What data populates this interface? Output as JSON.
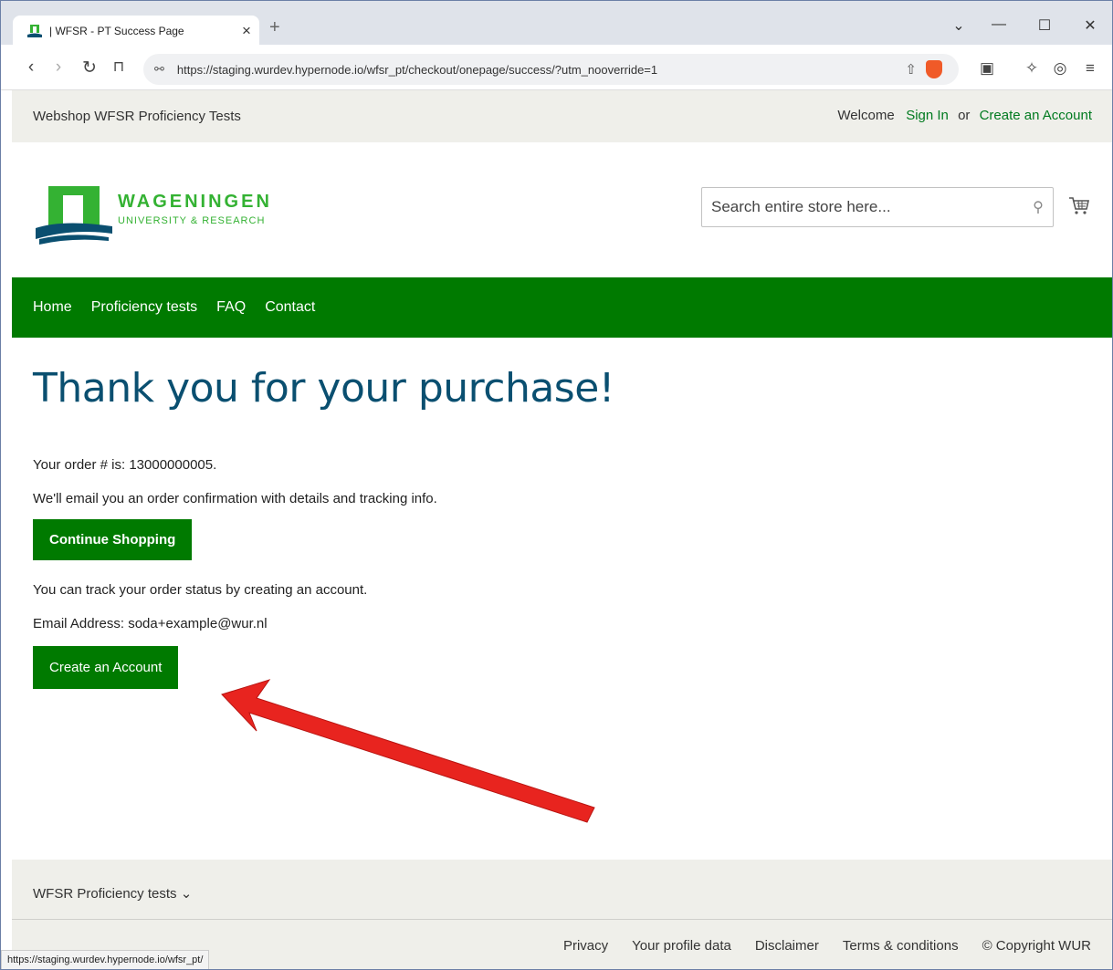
{
  "browser": {
    "tab_title": "| WFSR - PT Success Page",
    "url": "https://staging.wurdev.hypernode.io/wfsr_pt/checkout/onepage/success/?utm_nooverride=1",
    "status_url": "https://staging.wurdev.hypernode.io/wfsr_pt/"
  },
  "topbar": {
    "store_name": "Webshop WFSR Proficiency Tests",
    "welcome": "Welcome",
    "sign_in": "Sign In",
    "or": "or",
    "create_account": "Create an Account"
  },
  "header": {
    "logo_line1": "WAGENINGEN",
    "logo_line2": "UNIVERSITY & RESEARCH",
    "search_placeholder": "Search entire store here..."
  },
  "nav": {
    "items": [
      "Home",
      "Proficiency tests",
      "FAQ",
      "Contact"
    ]
  },
  "main": {
    "heading": "Thank you for your purchase!",
    "order_line": "Your order # is: 13000000005.",
    "email_line": "We'll email you an order confirmation with details and tracking info.",
    "continue_button": "Continue Shopping",
    "track_line": "You can track your order status by creating an account.",
    "address_line": "Email Address: soda+example@wur.nl",
    "create_button": "Create an Account"
  },
  "footer": {
    "title": "WFSR Proficiency tests",
    "links": [
      "Privacy",
      "Your profile data",
      "Disclaimer",
      "Terms & conditions",
      "© Copyright WUR"
    ]
  },
  "colors": {
    "brand_green": "#007a00",
    "heading_blue": "#0a4f70",
    "arrow_red": "#e8241f"
  }
}
